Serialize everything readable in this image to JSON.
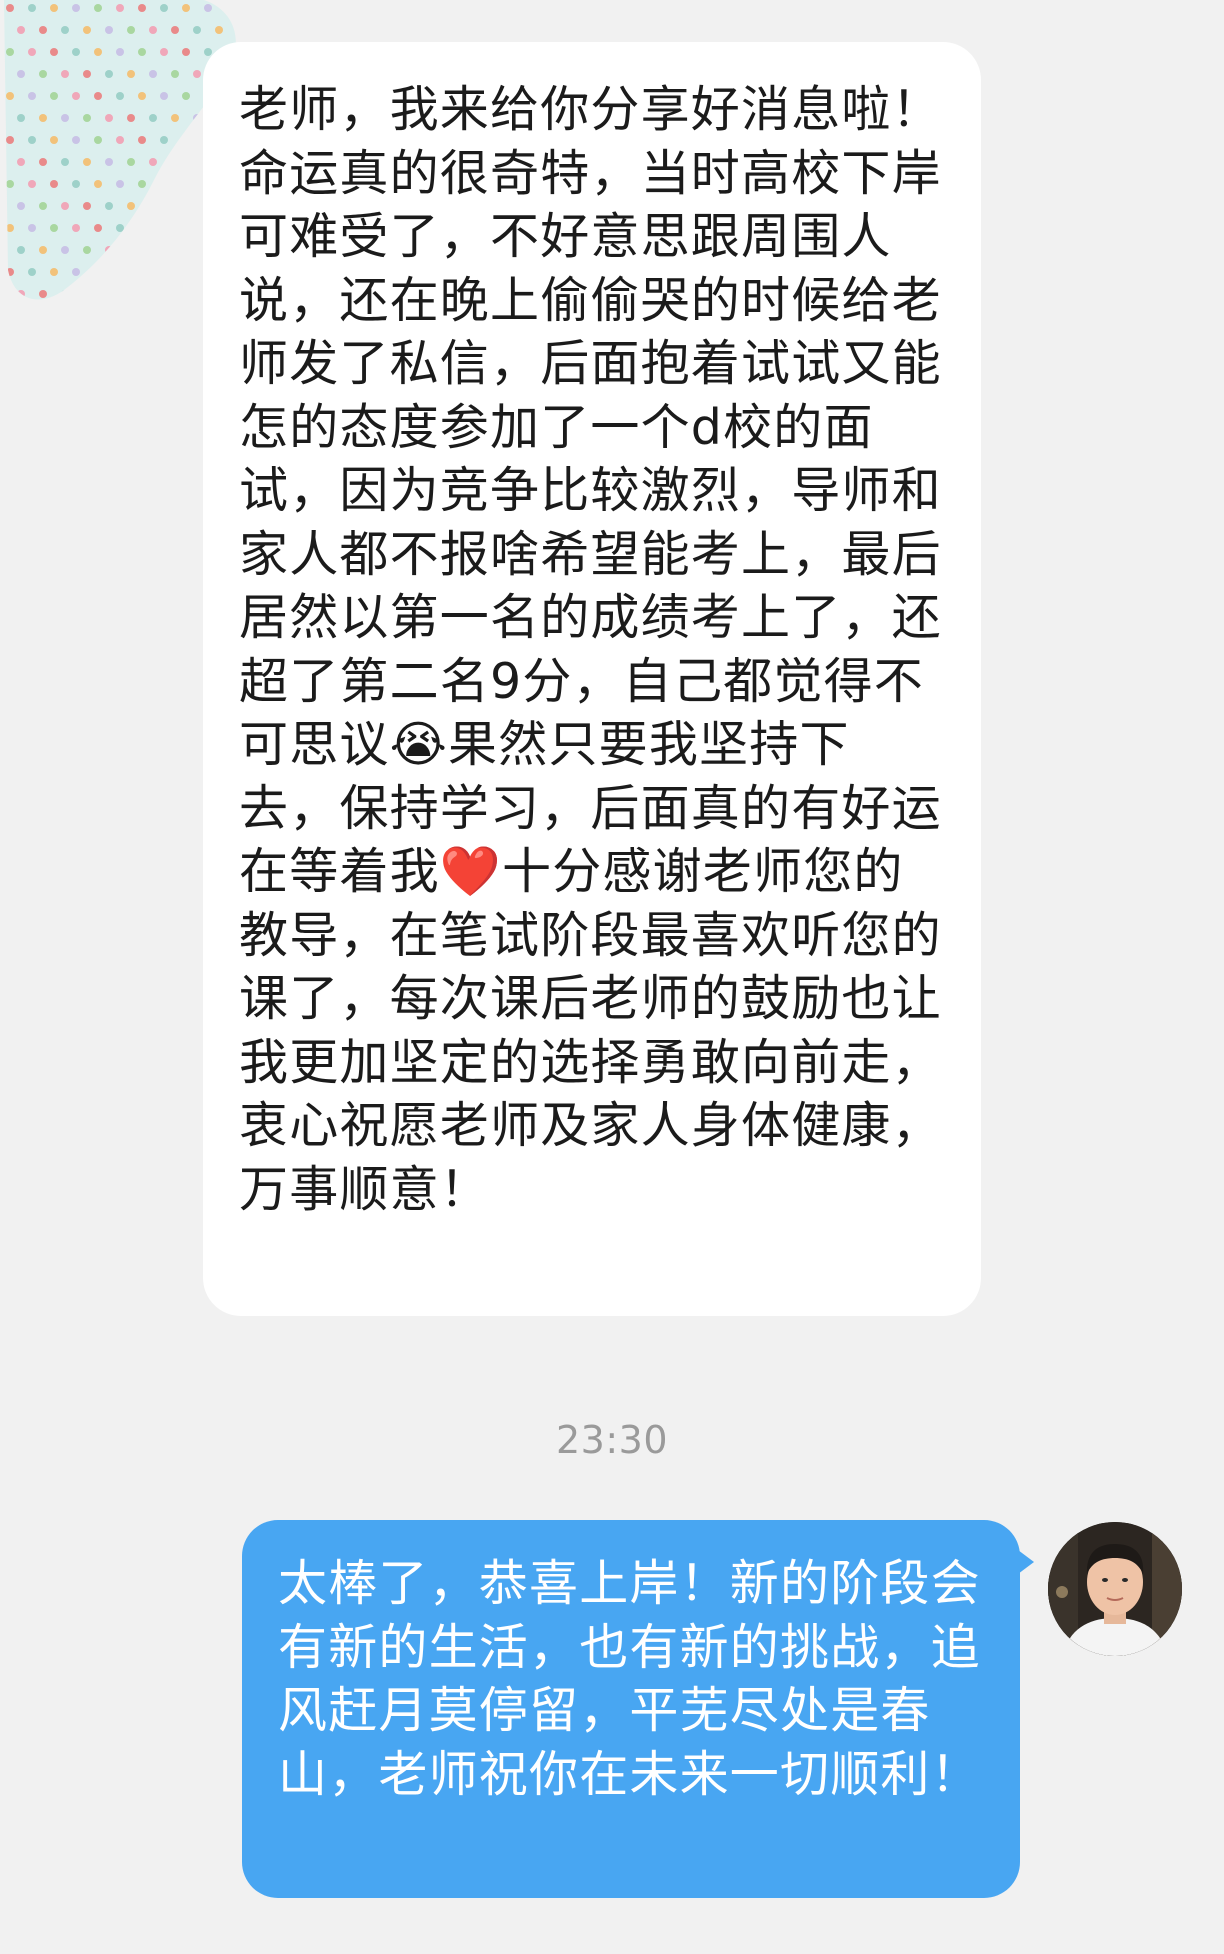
{
  "incoming_message": {
    "text": "老师，我来给你分享好消息啦！命运真的很奇特，当时高校下岸可难受了，不好意思跟周围人说，还在晚上偷偷哭的时候给老师发了私信，后面抱着试试又能怎的态度参加了一个d校的面试，因为竞争比较激烈，导师和家人都不报啥希望能考上，最后居然以第一名的成绩考上了，还超了第二名9分，自己都觉得不可思议😭果然只要我坚持下去，保持学习，后面真的有好运在等着我❤️十分感谢老师您的教导，在笔试阶段最喜欢听您的课了，每次课后老师的鼓励也让我更加坚定的选择勇敢向前走，衷心祝愿老师及家人身体健康，万事顺意！"
  },
  "timestamp": "23:30",
  "outgoing_message": {
    "text": "太棒了，恭喜上岸！新的阶段会有新的生活，也有新的挑战，追风赶月莫停留，平芜尽处是春山，老师祝你在未来一切顺利！"
  },
  "colors": {
    "background": "#f1f1f1",
    "incoming_bubble": "#ffffff",
    "outgoing_bubble": "#48a6f2",
    "timestamp": "#9a9a9a"
  }
}
